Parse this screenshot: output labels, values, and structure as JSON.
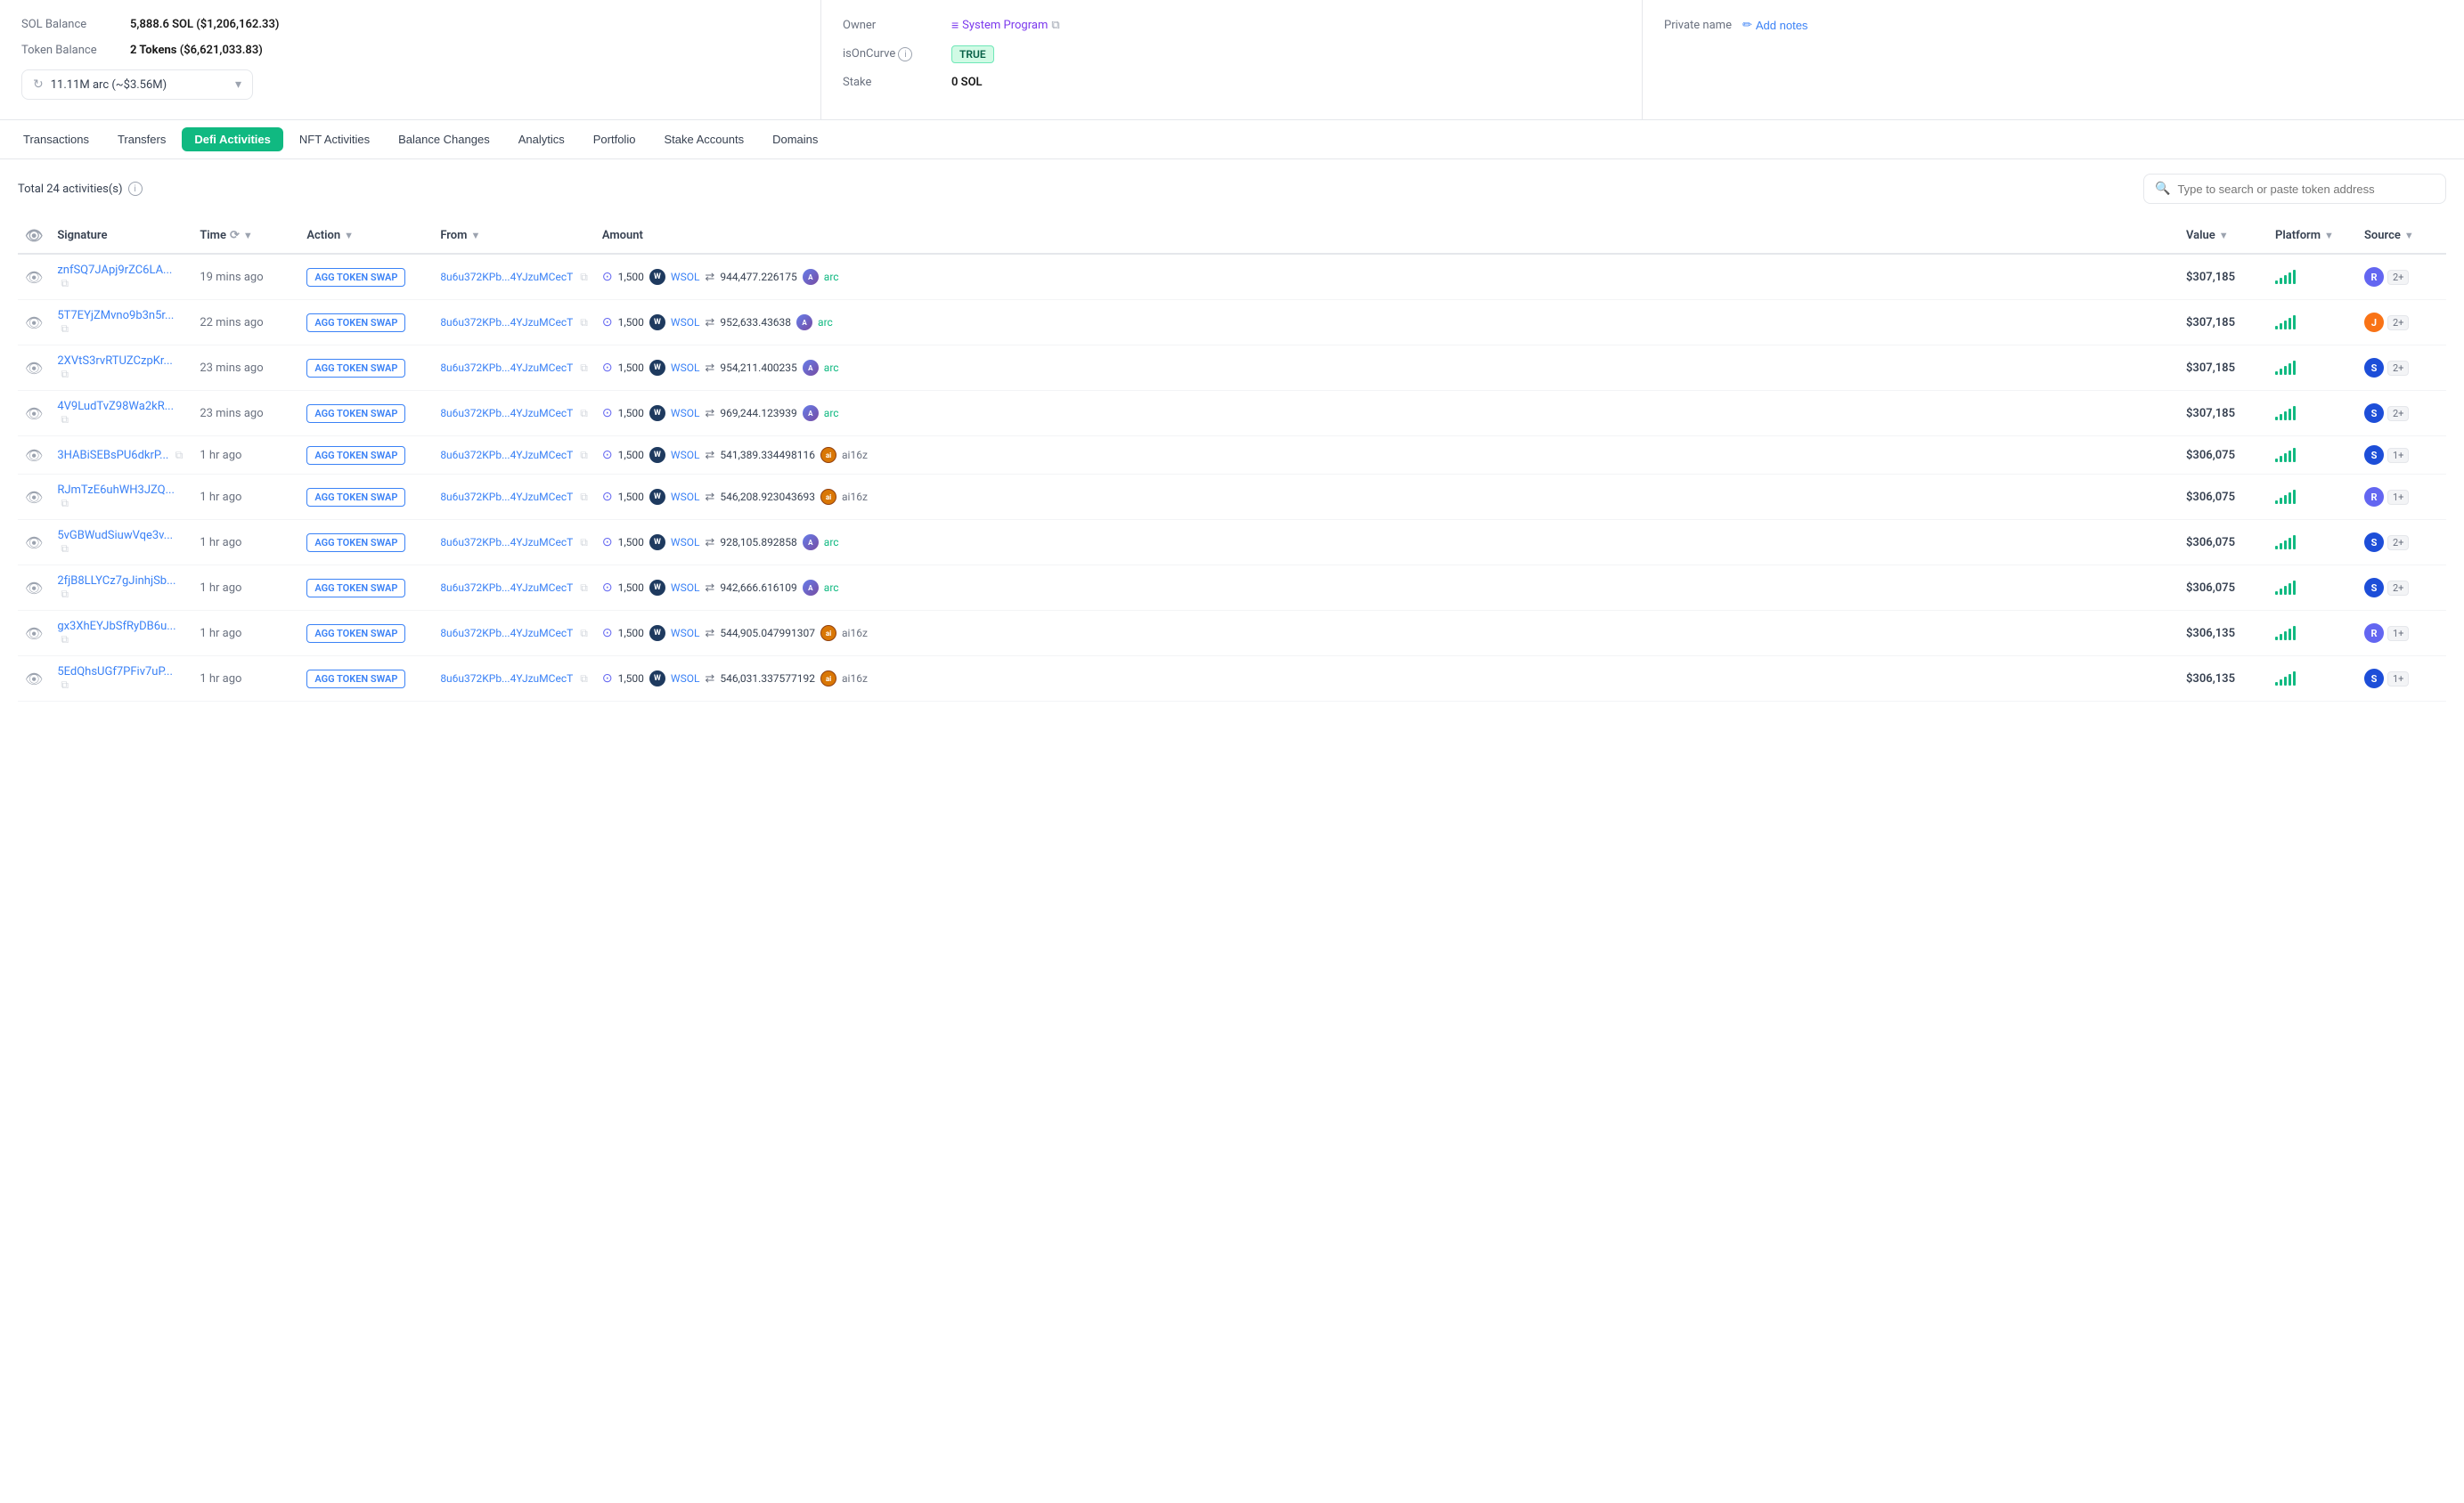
{
  "top": {
    "panel1": {
      "sol_balance_label": "SOL Balance",
      "sol_balance_value": "5,888.6 SOL",
      "sol_balance_usd": "($1,206,162.33)",
      "token_balance_label": "Token Balance",
      "token_balance_value": "2 Tokens",
      "token_balance_usd": "($6,621,033.83)",
      "token_selector_text": "11.11M arc (~$3.56M)"
    },
    "panel2": {
      "owner_label": "Owner",
      "owner_value": "System Program",
      "is_on_curve_label": "isOnCurve",
      "is_on_curve_value": "TRUE",
      "stake_label": "Stake",
      "stake_value": "0 SOL"
    },
    "panel3": {
      "private_name_label": "Private name",
      "add_notes_label": "Add notes"
    }
  },
  "tabs": [
    {
      "id": "transactions",
      "label": "Transactions",
      "active": false
    },
    {
      "id": "transfers",
      "label": "Transfers",
      "active": false
    },
    {
      "id": "defi",
      "label": "Defi Activities",
      "active": true
    },
    {
      "id": "nft",
      "label": "NFT Activities",
      "active": false
    },
    {
      "id": "balance",
      "label": "Balance Changes",
      "active": false
    },
    {
      "id": "analytics",
      "label": "Analytics",
      "active": false
    },
    {
      "id": "portfolio",
      "label": "Portfolio",
      "active": false
    },
    {
      "id": "stake",
      "label": "Stake Accounts",
      "active": false
    },
    {
      "id": "domains",
      "label": "Domains",
      "active": false
    }
  ],
  "main": {
    "total_activities": "Total 24 activities(s)",
    "search_placeholder": "Type to search or paste token address",
    "columns": {
      "signature": "Signature",
      "time": "Time",
      "action": "Action",
      "from": "From",
      "amount": "Amount",
      "value": "Value",
      "platform": "Platform",
      "source": "Source"
    },
    "rows": [
      {
        "sig": "znfSQ7JApj9rZC6LA...",
        "time": "19 mins ago",
        "action": "AGG TOKEN SWAP",
        "from": "8u6u372KPb...4YJzuMCecT",
        "amount_in": "1,500",
        "amount_token": "WSOL",
        "amount_out": "944,477.226175",
        "amount_link": "arc",
        "value": "$307,185",
        "platform_signal": 5,
        "source_color": "#6366f1",
        "source_letter": "R",
        "count": "2+"
      },
      {
        "sig": "5T7EYjZMvno9b3n5r...",
        "time": "22 mins ago",
        "action": "AGG TOKEN SWAP",
        "from": "8u6u372KPb...4YJzuMCecT",
        "amount_in": "1,500",
        "amount_token": "WSOL",
        "amount_out": "952,633.43638",
        "amount_link": "arc",
        "value": "$307,185",
        "platform_signal": 5,
        "source_color": "#f97316",
        "source_letter": "J",
        "count": "2+"
      },
      {
        "sig": "2XVtS3rvRTUZCzpKr...",
        "time": "23 mins ago",
        "action": "AGG TOKEN SWAP",
        "from": "8u6u372KPb...4YJzuMCecT",
        "amount_in": "1,500",
        "amount_token": "WSOL",
        "amount_out": "954,211.400235",
        "amount_link": "arc",
        "value": "$307,185",
        "platform_signal": 5,
        "source_color": "#1d4ed8",
        "source_letter": "S",
        "count": "2+"
      },
      {
        "sig": "4V9LudTvZ98Wa2kR...",
        "time": "23 mins ago",
        "action": "AGG TOKEN SWAP",
        "from": "8u6u372KPb...4YJzuMCecT",
        "amount_in": "1,500",
        "amount_token": "WSOL",
        "amount_out": "969,244.123939",
        "amount_link": "arc",
        "value": "$307,185",
        "platform_signal": 5,
        "source_color": "#1d4ed8",
        "source_letter": "S",
        "count": "2+"
      },
      {
        "sig": "3HABiSEBsPU6dkrP...",
        "time": "1 hr ago",
        "action": "AGG TOKEN SWAP",
        "from": "8u6u372KPb...4YJzuMCecT",
        "amount_in": "1,500",
        "amount_token": "WSOL",
        "amount_out": "541,389.334498116",
        "amount_link": "ai16z",
        "value": "$306,075",
        "platform_signal": 5,
        "source_color": "#1d4ed8",
        "source_letter": "S",
        "count": "1+"
      },
      {
        "sig": "RJmTzE6uhWH3JZQ...",
        "time": "1 hr ago",
        "action": "AGG TOKEN SWAP",
        "from": "8u6u372KPb...4YJzuMCecT",
        "amount_in": "1,500",
        "amount_token": "WSOL",
        "amount_out": "546,208.923043693",
        "amount_link": "ai16z",
        "value": "$306,075",
        "platform_signal": 5,
        "source_color": "#6366f1",
        "source_letter": "R",
        "count": "1+"
      },
      {
        "sig": "5vGBWudSiuwVqe3v...",
        "time": "1 hr ago",
        "action": "AGG TOKEN SWAP",
        "from": "8u6u372KPb...4YJzuMCecT",
        "amount_in": "1,500",
        "amount_token": "WSOL",
        "amount_out": "928,105.892858",
        "amount_link": "arc",
        "value": "$306,075",
        "platform_signal": 5,
        "source_color": "#1d4ed8",
        "source_letter": "S",
        "count": "2+"
      },
      {
        "sig": "2fjB8LLYCz7gJinhjSb...",
        "time": "1 hr ago",
        "action": "AGG TOKEN SWAP",
        "from": "8u6u372KPb...4YJzuMCecT",
        "amount_in": "1,500",
        "amount_token": "WSOL",
        "amount_out": "942,666.616109",
        "amount_link": "arc",
        "value": "$306,075",
        "platform_signal": 5,
        "source_color": "#1d4ed8",
        "source_letter": "S",
        "count": "2+"
      },
      {
        "sig": "gx3XhEYJbSfRyDB6u...",
        "time": "1 hr ago",
        "action": "AGG TOKEN SWAP",
        "from": "8u6u372KPb...4YJzuMCecT",
        "amount_in": "1,500",
        "amount_token": "WSOL",
        "amount_out": "544,905.047991307",
        "amount_link": "ai16z",
        "value": "$306,135",
        "platform_signal": 5,
        "source_color": "#6366f1",
        "source_letter": "R",
        "count": "1+"
      },
      {
        "sig": "5EdQhsUGf7PFiv7uP...",
        "time": "1 hr ago",
        "action": "AGG TOKEN SWAP",
        "from": "8u6u372KPb...4YJzuMCecT",
        "amount_in": "1,500",
        "amount_token": "WSOL",
        "amount_out": "546,031.337577192",
        "amount_link": "ai16z",
        "value": "$306,135",
        "platform_signal": 5,
        "source_color": "#1d4ed8",
        "source_letter": "S",
        "count": "1+"
      }
    ]
  }
}
